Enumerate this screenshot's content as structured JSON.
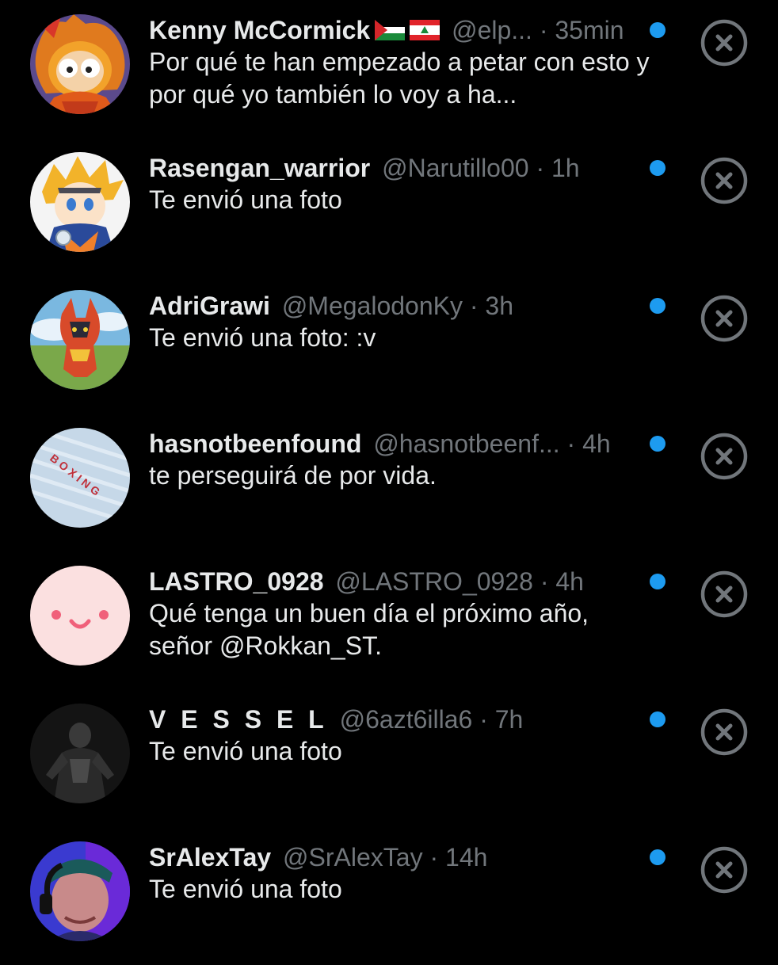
{
  "accent_color": "#1d9bf0",
  "muted_color": "#71767b",
  "text_color": "#e7e9ea",
  "background_color": "#000000",
  "conversations": [
    {
      "name": "Kenny McCormick",
      "flags": [
        "palestine-flag",
        "lebanon-flag"
      ],
      "handle": "@elp...",
      "separator": "·",
      "time": "35min",
      "message": "Por qué te han empezado a petar con esto y por qué yo también lo voy a ha...",
      "unread": true,
      "avatar": "south-park-kenny-avatar"
    },
    {
      "name": "Rasengan_warrior",
      "handle": "@Narutillo00",
      "separator": "·",
      "time": "1h",
      "message": "Te envió una foto",
      "unread": true,
      "avatar": "anime-character-avatar"
    },
    {
      "name": "AdriGrawi",
      "handle": "@MegalodonKy",
      "separator": "·",
      "time": "3h",
      "message": "Te envió una foto: :v",
      "unread": true,
      "avatar": "red-creature-avatar"
    },
    {
      "name": "hasnotbeenfound",
      "handle": "@hasnotbeenf...",
      "separator": "·",
      "time": "4h",
      "message": "te perseguirá de por vida.",
      "unread": true,
      "avatar": "boxing-fabric-avatar",
      "avatar_text": "BOXING"
    },
    {
      "name": "LASTRO_0928",
      "handle": "@LASTRO_0928",
      "separator": "·",
      "time": "4h",
      "message": "Qué tenga un buen día el próximo año, señor @Rokkan_ST.",
      "unread": true,
      "avatar": "pink-smiley-avatar"
    },
    {
      "name": "V E S S E L",
      "handle": "@6azt6illa6",
      "separator": "·",
      "time": "7h",
      "message": "Te envió una foto",
      "unread": true,
      "avatar": "dark-figure-avatar"
    },
    {
      "name": "SrAlexTay",
      "handle": "@SrAlexTay",
      "separator": "·",
      "time": "14h",
      "message": "Te envió una foto",
      "unread": true,
      "avatar": "headset-person-avatar"
    }
  ],
  "dismiss_icon": "circle-x-icon"
}
